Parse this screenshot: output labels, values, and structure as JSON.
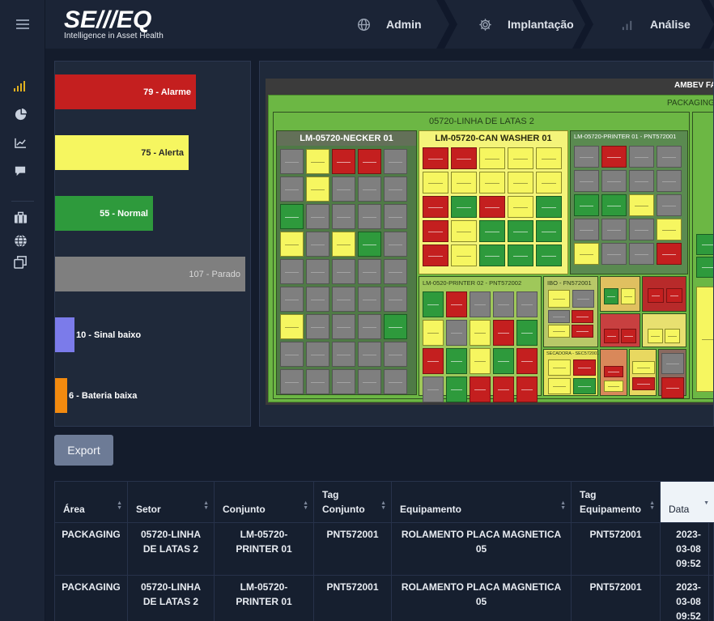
{
  "header": {
    "logo_main": "SE///EQ",
    "logo_sub": "Intelligence in Asset Health",
    "nav": [
      {
        "label": "Admin",
        "icon": "globe-icon"
      },
      {
        "label": "Implantação",
        "icon": "gear-icon"
      },
      {
        "label": "Análise",
        "icon": "bar-chart-icon"
      }
    ]
  },
  "sidebar": {
    "items": [
      "signal-bars-icon",
      "pie-chart-icon",
      "line-chart-icon",
      "chat-icon",
      "briefcase-icon",
      "globe-icon",
      "windows-icon"
    ]
  },
  "status_bars": [
    {
      "label": "79 - Alarme",
      "value": 79,
      "color": "#c41f1f"
    },
    {
      "label": "75 - Alerta",
      "value": 75,
      "color": "#f6f660"
    },
    {
      "label": "55 - Normal",
      "value": 55,
      "color": "#2e9a3c"
    },
    {
      "label": "107 - Parado",
      "value": 107,
      "color": "#7f7f7f"
    },
    {
      "label": "10 - Sinal baixo",
      "value": 10,
      "color": "#7b7bea"
    },
    {
      "label": "6 - Bateria baixa",
      "value": 6,
      "color": "#f28a0f"
    }
  ],
  "treemap": {
    "root": "AMBEV FA",
    "area": "PACKAGING",
    "sector": "05720-LINHA DE LATAS 2",
    "groups": {
      "necker": "LM-05720-NECKER 01",
      "washer": "LM-05720-CAN WASHER 01",
      "printer1": "LM-05720-PRINTER 01 - PNT572001",
      "printer2": "LM-0520-PRINTER 02 - PNT572002",
      "ibo": "IBO - FN572001",
      "secadora": "SECADORA - SEC572001"
    }
  },
  "export_label": "Export",
  "table": {
    "columns": [
      "Área",
      "Setor",
      "Conjunto",
      "Tag Conjunto",
      "Equipamento",
      "Tag Equipamento",
      "Data"
    ],
    "rows": [
      [
        "PACKAGING",
        "05720-LINHA DE LATAS 2",
        "LM-05720-PRINTER 01",
        "PNT572001",
        "ROLAMENTO PLACA MAGNETICA 05",
        "PNT572001",
        "2023-03-08 09:52"
      ],
      [
        "PACKAGING",
        "05720-LINHA DE LATAS 2",
        "LM-05720-PRINTER 01",
        "PNT572001",
        "ROLAMENTO PLACA MAGNETICA 05",
        "PNT572001",
        "2023-03-08 09:52"
      ]
    ]
  }
}
